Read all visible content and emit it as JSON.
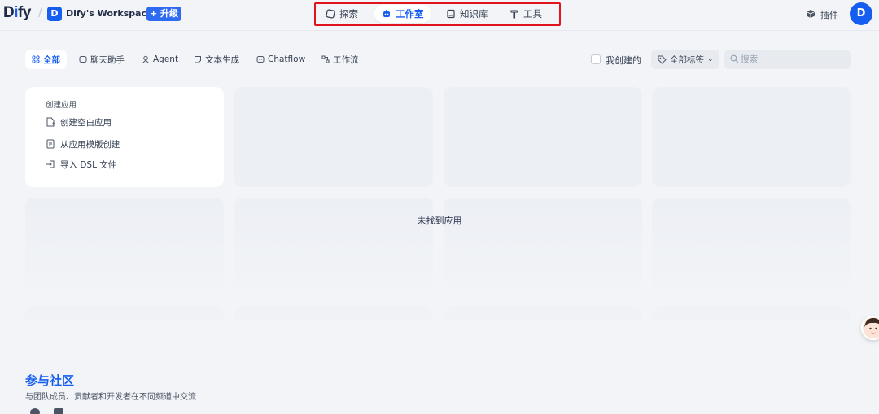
{
  "header": {
    "logo_pre": "D",
    "logo_i": "i",
    "logo_post": "fy",
    "workspace_initial": "D",
    "workspace_name": "Dify's Workspace",
    "upgrade_label": "+ 升级",
    "nav": [
      {
        "label": "探索",
        "icon": "explore-icon"
      },
      {
        "label": "工作室",
        "icon": "robot-icon"
      },
      {
        "label": "知识库",
        "icon": "book-icon"
      },
      {
        "label": "工具",
        "icon": "hammer-icon"
      }
    ],
    "plugin_label": "插件",
    "avatar_initial": "D"
  },
  "filters": {
    "tabs": [
      {
        "label": "全部",
        "icon": "grid-icon"
      },
      {
        "label": "聊天助手",
        "icon": "chat-icon"
      },
      {
        "label": "Agent",
        "icon": "agent-icon"
      },
      {
        "label": "文本生成",
        "icon": "text-icon"
      },
      {
        "label": "Chatflow",
        "icon": "chatflow-icon"
      },
      {
        "label": "工作流",
        "icon": "workflow-icon"
      }
    ],
    "mine_label": "我创建的",
    "tags_label": "全部标签",
    "search_placeholder": "搜索"
  },
  "create": {
    "title": "创建应用",
    "items": [
      {
        "label": "创建空白应用",
        "icon": "new-file-icon"
      },
      {
        "label": "从应用模版创建",
        "icon": "template-icon"
      },
      {
        "label": "导入 DSL 文件",
        "icon": "import-icon"
      }
    ]
  },
  "empty_message": "未找到应用",
  "community": {
    "title": "参与社区",
    "subtitle": "与团队成员、贡献者和开发者在不同频道中交流"
  },
  "colors": {
    "accent": "#155eef",
    "highlight_box": "#e0141c",
    "background": "#f2f4f7"
  }
}
